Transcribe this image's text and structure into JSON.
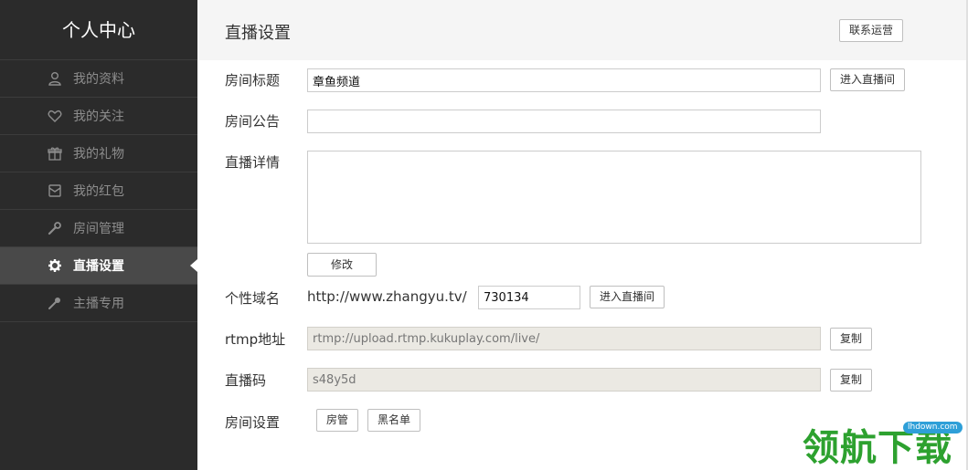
{
  "sidebar": {
    "title": "个人中心",
    "items": [
      {
        "label": "我的资料",
        "icon": "user-icon"
      },
      {
        "label": "我的关注",
        "icon": "heart-icon"
      },
      {
        "label": "我的礼物",
        "icon": "gift-icon"
      },
      {
        "label": "我的红包",
        "icon": "red-packet-icon"
      },
      {
        "label": "房间管理",
        "icon": "wrench-icon"
      },
      {
        "label": "直播设置",
        "icon": "gear-icon",
        "active": true
      },
      {
        "label": "主播专用",
        "icon": "key-icon"
      }
    ]
  },
  "header": {
    "title": "直播设置",
    "contact_label": "联系运营"
  },
  "form": {
    "room_title": {
      "label": "房间标题",
      "value": "章鱼频道",
      "enter_label": "进入直播间"
    },
    "announcement": {
      "label": "房间公告",
      "value": ""
    },
    "details": {
      "label": "直播详情",
      "value": "",
      "modify_label": "修改"
    },
    "domain": {
      "label": "个性域名",
      "prefix": "http://www.zhangyu.tv/",
      "value": "730134",
      "enter_label": "进入直播间"
    },
    "rtmp": {
      "label": "rtmp地址",
      "value": "rtmp://upload.rtmp.kukuplay.com/live/",
      "copy_label": "复制"
    },
    "stream_code": {
      "label": "直播码",
      "value": "s48y5d",
      "copy_label": "复制"
    },
    "room_settings": {
      "label": "房间设置",
      "admin_label": "房管",
      "blacklist_label": "黑名单"
    }
  },
  "watermark": {
    "text": "领航下载",
    "site": "lhdown.com"
  },
  "colors": {
    "sidebar_bg": "#2b2b2b",
    "active_bg": "#494949",
    "header_bg": "#f5f5f5",
    "watermark": "#2da12f"
  }
}
